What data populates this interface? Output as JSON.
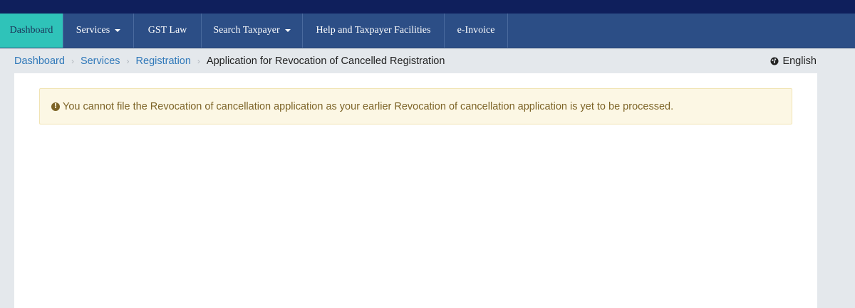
{
  "nav": {
    "items": [
      {
        "label": "Dashboard",
        "active": true,
        "dropdown": false
      },
      {
        "label": "Services",
        "active": false,
        "dropdown": true
      },
      {
        "label": "GST Law",
        "active": false,
        "dropdown": false
      },
      {
        "label": "Search Taxpayer",
        "active": false,
        "dropdown": true
      },
      {
        "label": "Help and Taxpayer Facilities",
        "active": false,
        "dropdown": false
      },
      {
        "label": "e-Invoice",
        "active": false,
        "dropdown": false
      }
    ]
  },
  "breadcrumb": {
    "items": [
      "Dashboard",
      "Services",
      "Registration"
    ],
    "current": "Application for Revocation of Cancelled Registration"
  },
  "language": {
    "label": "English",
    "icon": "globe-icon"
  },
  "alert": {
    "icon": "exclamation-circle-icon",
    "message": "You cannot file the Revocation of cancellation application as your earlier Revocation of cancellation application is yet to be processed."
  },
  "colors": {
    "topbar": "#0f1f5c",
    "navbar": "#2c4e86",
    "nav_active": "#2fc3b9",
    "link": "#2f78b9",
    "alert_bg": "#fcf7e4",
    "alert_text": "#7d6427"
  }
}
